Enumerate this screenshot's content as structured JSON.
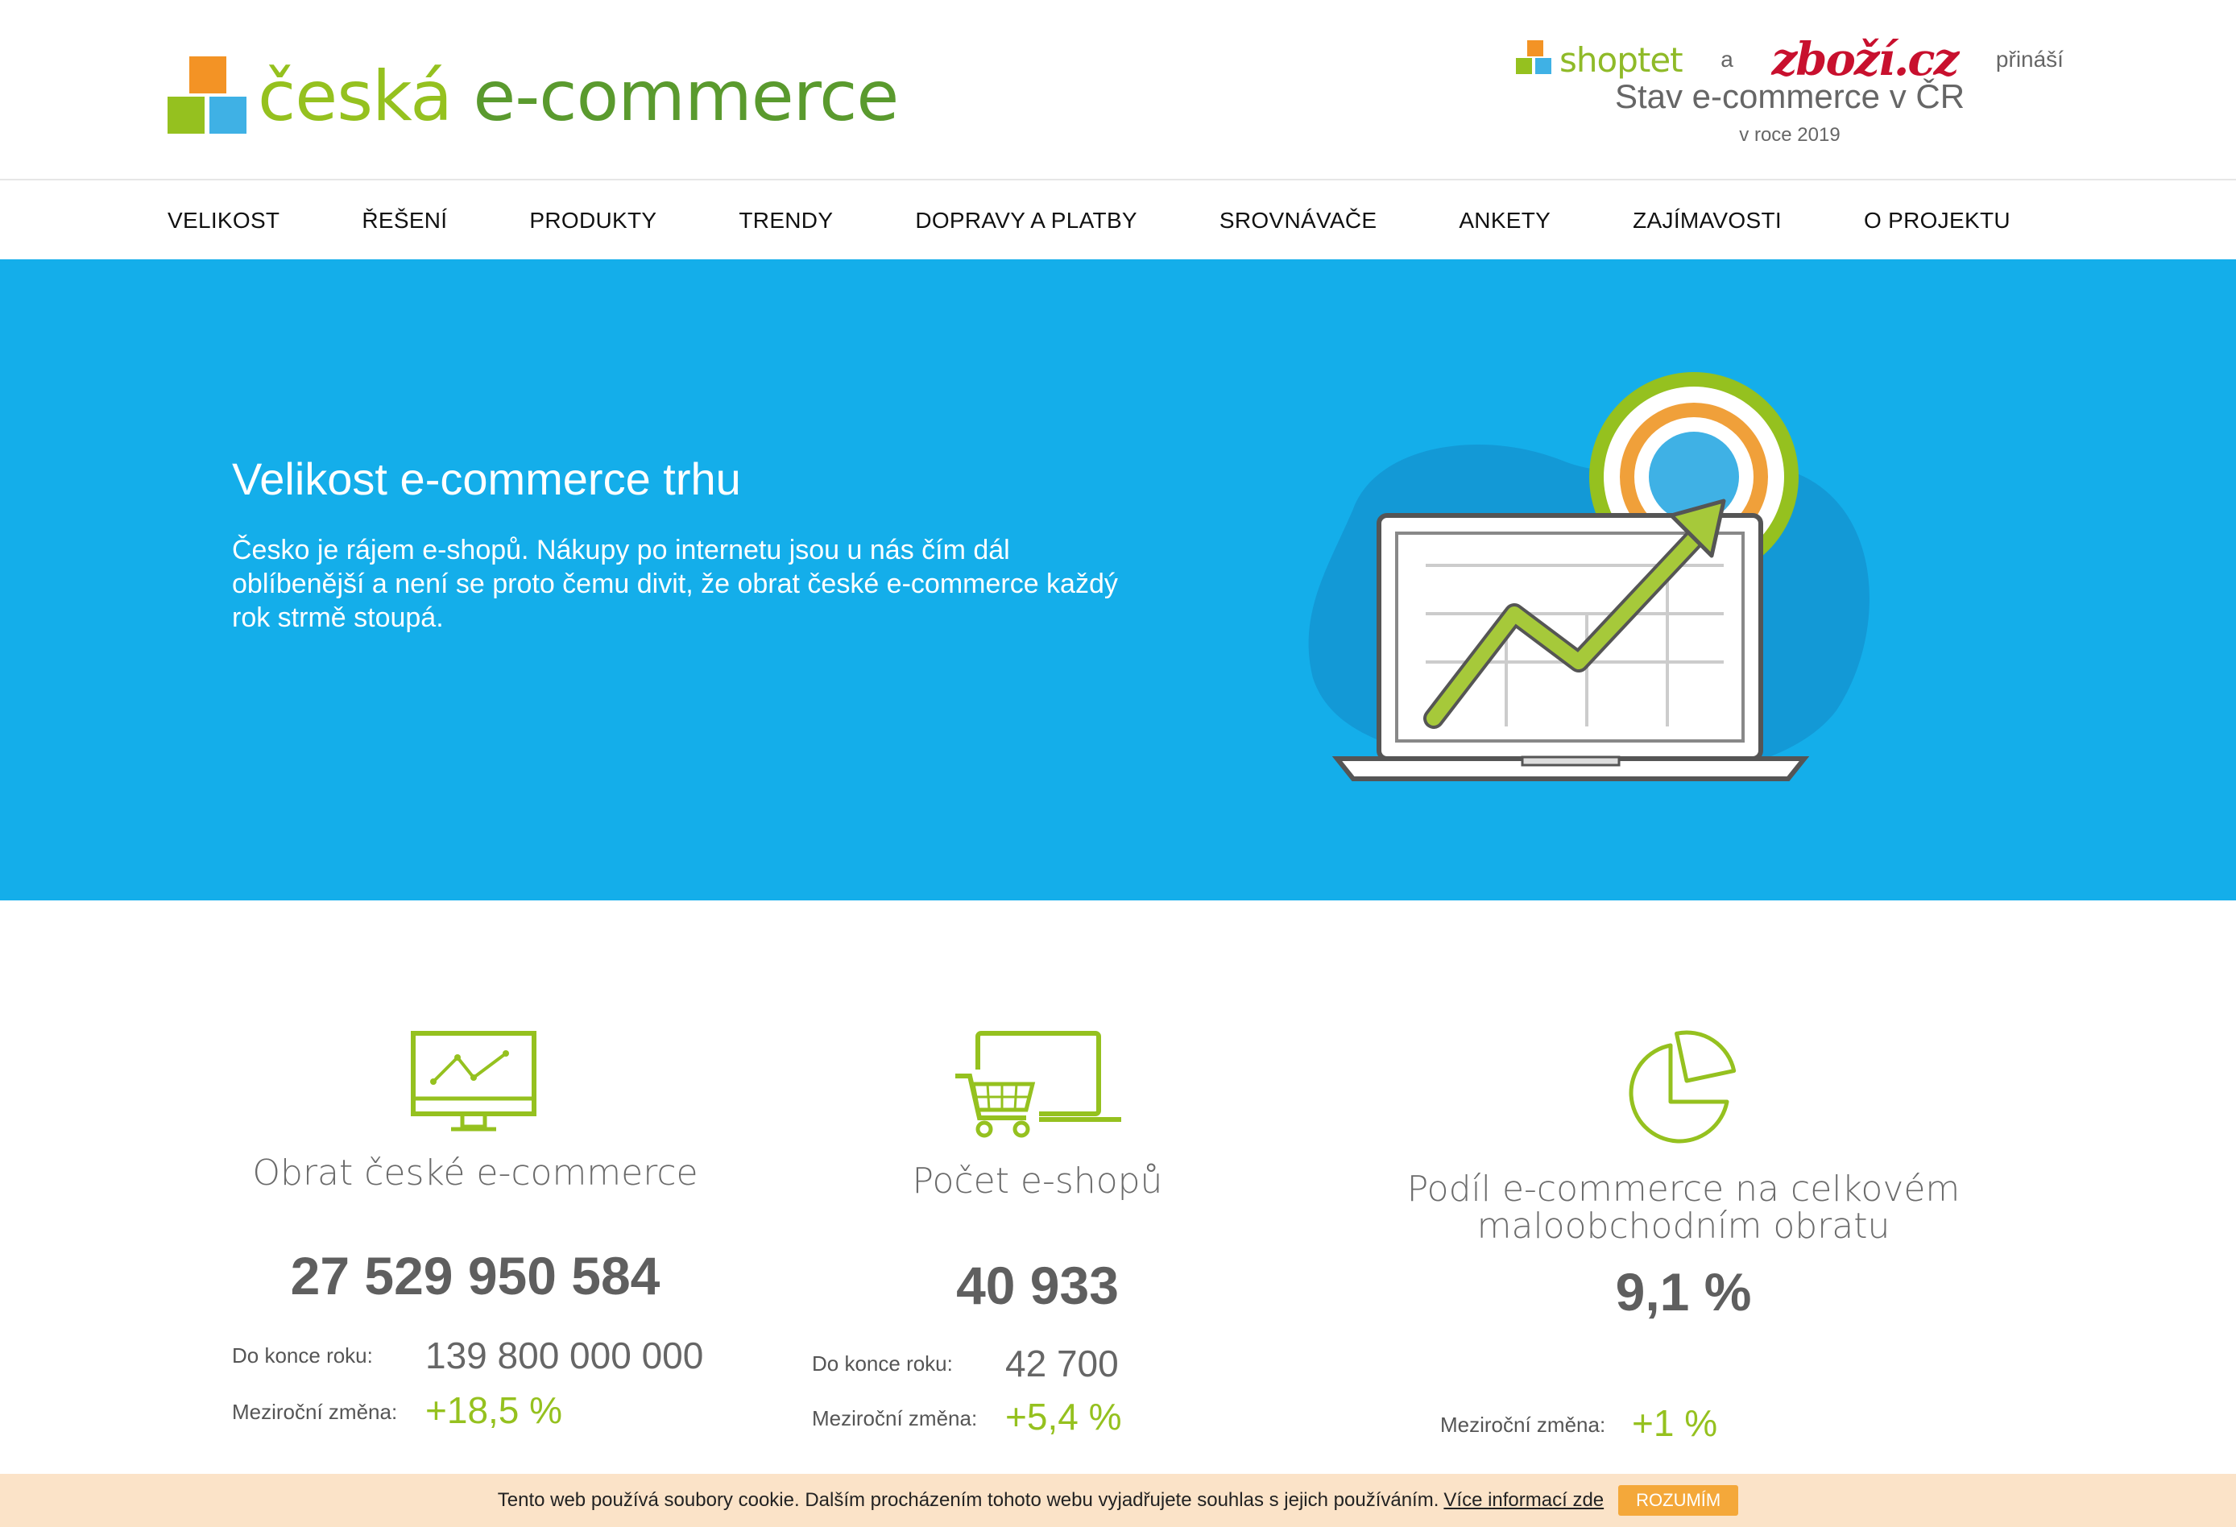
{
  "header": {
    "logo": {
      "word1": "česká",
      "word2": "e-commerce"
    },
    "partner": {
      "shoptet": "shoptet",
      "and": "a",
      "zbozi": "zboží.cz",
      "brings": "přináší",
      "title": "Stav e-commerce v ČR",
      "subtitle": "v roce 2019"
    }
  },
  "nav": {
    "items": [
      {
        "label": "VELIKOST"
      },
      {
        "label": "ŘEŠENÍ"
      },
      {
        "label": "PRODUKTY"
      },
      {
        "label": "TRENDY"
      },
      {
        "label": "DOPRAVY A PLATBY"
      },
      {
        "label": "SROVNÁVAČE"
      },
      {
        "label": "ANKETY"
      },
      {
        "label": "ZAJÍMAVOSTI"
      },
      {
        "label": "O PROJEKTU"
      }
    ]
  },
  "hero": {
    "title": "Velikost e-commerce trhu",
    "text": "Česko je rájem e-shopů. Nákupy po internetu jsou u nás čím dál oblíbenější a není se proto čemu divit, že obrat české e-commerce každý rok strmě stoupá."
  },
  "stats": [
    {
      "icon": "monitor-chart-icon",
      "title": "Obrat české e-commerce",
      "value": "27 529 950 584",
      "year_end_label": "Do konce roku:",
      "year_end_value": "139 800 000 000",
      "change_label": "Meziroční změna:",
      "change_value": "+18,5 %"
    },
    {
      "icon": "laptop-cart-icon",
      "title": "Počet e-shopů",
      "value": "40 933",
      "year_end_label": "Do konce roku:",
      "year_end_value": "42 700",
      "change_label": "Meziroční změna:",
      "change_value": "+5,4 %"
    },
    {
      "icon": "pie-chart-icon",
      "title": "Podíl e-commerce na celkovém maloobchodním obratu",
      "value": "9,1 %",
      "change_label": "Meziroční změna:",
      "change_value": "+1 %"
    }
  ],
  "cookie": {
    "text": "Tento web používá soubory cookie. Dalším procházením tohoto webu vyjadřujete souhlas s jejich používáním.",
    "link": "Více informací zde",
    "button": "ROZUMÍM"
  },
  "colors": {
    "hero_bg": "#14aeea",
    "accent_green": "#95c11f",
    "accent_orange": "#f39325",
    "cookie_bg": "#fbe3c8"
  }
}
